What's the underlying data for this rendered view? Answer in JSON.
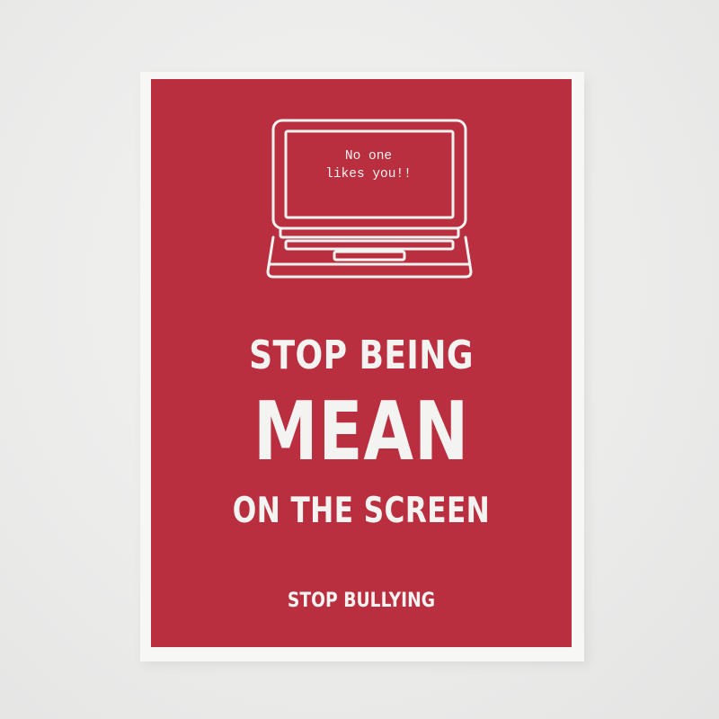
{
  "poster": {
    "screen_lines": [
      "No one",
      "likes you!!"
    ],
    "headline_line1": "STOP BEING",
    "headline_line2": "MEAN",
    "headline_line3": "ON THE SCREEN",
    "tagline": "STOP BULLYING",
    "icon": "laptop-icon"
  },
  "colors": {
    "panel": "#b92f3f",
    "text": "#f3f3f1",
    "border": "#f7f7f6",
    "wall": "#ececeb"
  }
}
